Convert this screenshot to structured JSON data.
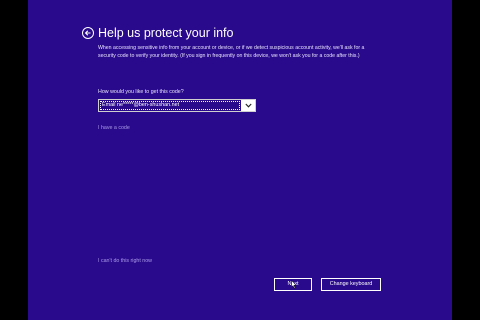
{
  "page": {
    "title": "Help us protect your info",
    "description": "When accessing sensitive info from your account or device, or if we detect suspicious account activity, we'll ask for a security code to verify your identity. (If you sign in frequently on this device, we won't ask you for a code after this.)",
    "question": "How would you like to get this code?",
    "code_method": {
      "selected": "Email ne*****@ben-shushan.net"
    },
    "have_code_link": "I have a code",
    "cant_do_link": "I can't do this right now"
  },
  "buttons": {
    "next": "Next",
    "change_keyboard": "Change keyboard"
  },
  "icons": {
    "back": "back-arrow-icon",
    "dropdown": "chevron-down-icon",
    "cursor": "mouse-pointer-icon"
  },
  "colors": {
    "background": "#2a0a8c",
    "text": "#ffffff",
    "link": "#a99ae8"
  }
}
